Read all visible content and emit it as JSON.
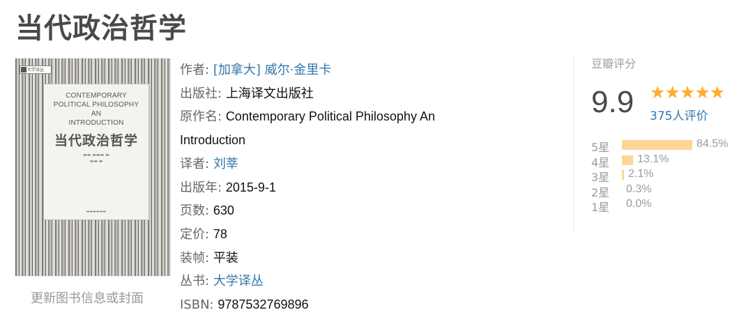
{
  "book_title": "当代政治哲学",
  "cover": {
    "badge": "大学译丛",
    "en_title": "CONTEMPORARY\nPOLITICAL PHILOSOPHY\nAN\nINTRODUCTION",
    "cn_title": "当代政治哲学"
  },
  "update_link": "更新图书信息或封面",
  "info": {
    "author_label": "作者:",
    "author": "[加拿大] 威尔·金里卡",
    "publisher_label": "出版社:",
    "publisher": "上海译文出版社",
    "original_title_label": "原作名:",
    "original_title": "Contemporary Political Philosophy An Introduction",
    "translator_label": "译者:",
    "translator": "刘莘",
    "pub_year_label": "出版年:",
    "pub_year": "2015-9-1",
    "pages_label": "页数:",
    "pages": "630",
    "price_label": "定价:",
    "price": "78",
    "binding_label": "装帧:",
    "binding": "平装",
    "series_label": "丛书:",
    "series": "大学译丛",
    "isbn_label": "ISBN:",
    "isbn": "9787532769896"
  },
  "rating": {
    "label": "豆瓣评分",
    "score": "9.9",
    "stars_icon": "five-star-icon",
    "stars_glyphs": "★★★★★",
    "count": "375人评价",
    "distribution": [
      {
        "label": "5星",
        "pct": "84.5%",
        "fraction": 0.845
      },
      {
        "label": "4星",
        "pct": "13.1%",
        "fraction": 0.131
      },
      {
        "label": "3星",
        "pct": "2.1%",
        "fraction": 0.021
      },
      {
        "label": "2星",
        "pct": "0.3%",
        "fraction": 0.003
      },
      {
        "label": "1星",
        "pct": "0.0%",
        "fraction": 0.0
      }
    ],
    "bar_color": "#ffd596",
    "star_color": "#ffac2d",
    "link_color": "#3377aa"
  }
}
